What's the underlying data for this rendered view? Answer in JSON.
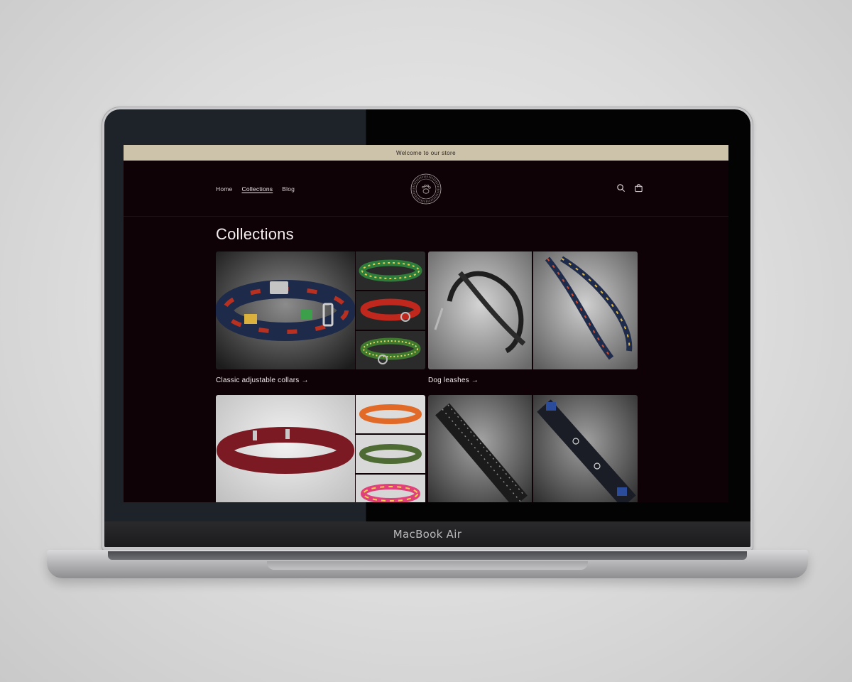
{
  "device": {
    "brand_label": "MacBook Air"
  },
  "store": {
    "announcement": "Welcome to our store",
    "nav": [
      {
        "label": "Home",
        "active": false
      },
      {
        "label": "Collections",
        "active": true
      },
      {
        "label": "Blog",
        "active": false
      }
    ],
    "icons": {
      "search": "search-icon",
      "cart": "cart-icon",
      "logo": "paw-seal-logo"
    },
    "page_title": "Collections",
    "collections": [
      {
        "title": "Classic adjustable collars",
        "arrow": "→"
      },
      {
        "title": "Dog leashes",
        "arrow": "→"
      },
      {
        "title": "",
        "arrow": ""
      },
      {
        "title": "",
        "arrow": ""
      }
    ],
    "colors": {
      "announcement_bg": "#cdc3ab",
      "page_bg": "#0e0206",
      "text": "#f0eaea"
    }
  }
}
